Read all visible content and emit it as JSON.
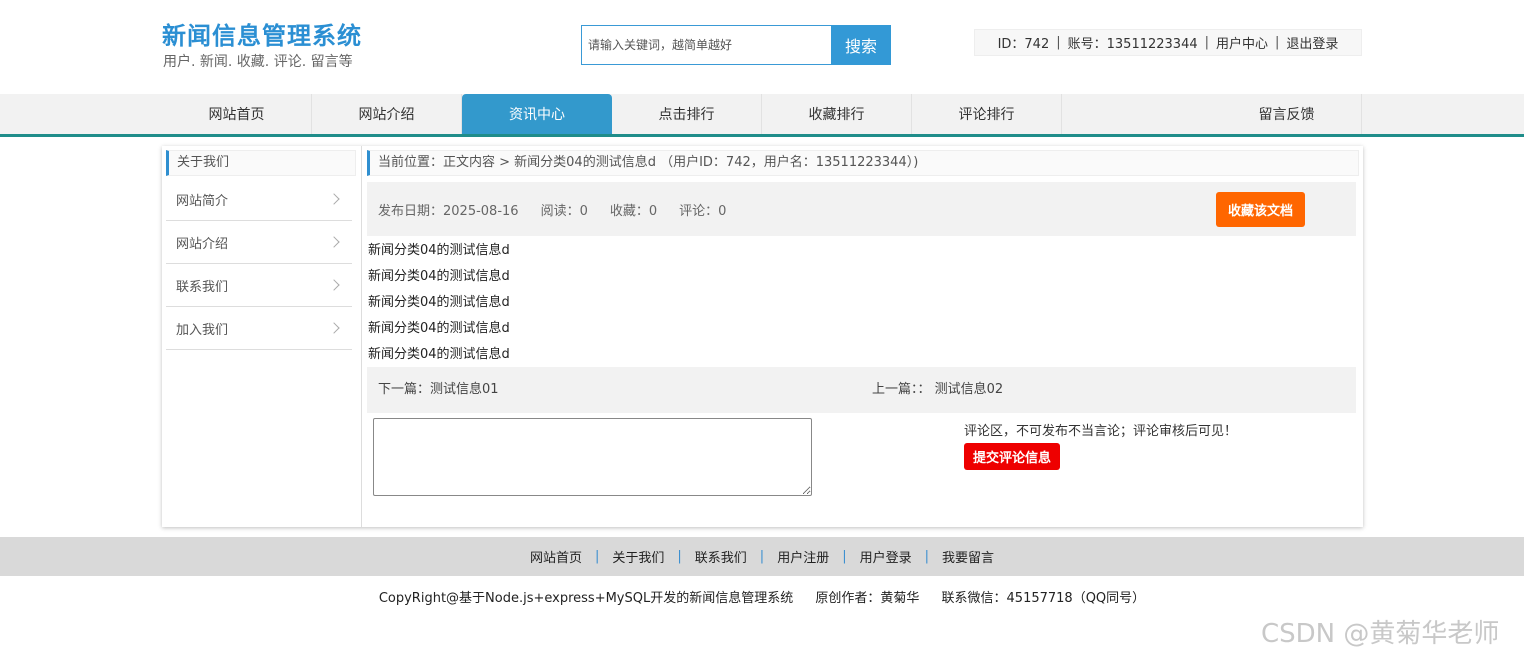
{
  "brand": {
    "title": "新闻信息管理系统",
    "subtitle": "用户. 新闻. 收藏. 评论. 留言等"
  },
  "search": {
    "placeholder": "请输入关键词，越简单越好",
    "value": "",
    "button": "搜索"
  },
  "userbar": {
    "id": "ID：742",
    "account": "账号：13511223344",
    "user_center": "用户中心",
    "logout": "退出登录"
  },
  "nav": [
    {
      "label": "网站首页",
      "active": false
    },
    {
      "label": "网站介绍",
      "active": false
    },
    {
      "label": "资讯中心",
      "active": true
    },
    {
      "label": "点击排行",
      "active": false
    },
    {
      "label": "收藏排行",
      "active": false
    },
    {
      "label": "评论排行",
      "active": false
    },
    {
      "label": "留言反馈",
      "active": false
    }
  ],
  "sidebar": {
    "title": "关于我们",
    "items": [
      {
        "label": "网站简介"
      },
      {
        "label": "网站介绍"
      },
      {
        "label": "联系我们"
      },
      {
        "label": "加入我们"
      }
    ]
  },
  "content": {
    "breadcrumb": "当前位置：正文内容 > 新闻分类04的测试信息d （用户ID：742，用户名：13511223344）)",
    "meta": {
      "date": "发布日期：2025-08-16",
      "views": "阅读：0",
      "favorites": "收藏：0",
      "comments": "评论：0",
      "favorite_button": "收藏该文档"
    },
    "body_lines": [
      "新闻分类04的测试信息d",
      "新闻分类04的测试信息d",
      "新闻分类04的测试信息d",
      "新闻分类04的测试信息d",
      "新闻分类04的测试信息d"
    ],
    "pager": {
      "next_label": "下一篇：",
      "next_title": "测试信息01",
      "prev_label": "上一篇：：",
      "prev_title": "测试信息02"
    },
    "comment": {
      "value": "",
      "note": "评论区，不可发布不当言论；评论审核后可见！",
      "submit": "提交评论信息"
    }
  },
  "footer": {
    "links": [
      "网站首页",
      "关于我们",
      "联系我们",
      "用户注册",
      "用户登录",
      "我要留言"
    ],
    "copyright": "CopyRight@基于Node.js+express+MySQL开发的新闻信息管理系统",
    "author": "原创作者：黄菊华",
    "contact": "联系微信：45157718（QQ同号）"
  },
  "watermark": "CSDN @黄菊华老师",
  "colors": {
    "brand": "#2b8fd3",
    "nav_active": "#3399cc",
    "nav_border": "#1f8d8a",
    "favorite": "#ff6600",
    "submit": "#ee0000"
  }
}
